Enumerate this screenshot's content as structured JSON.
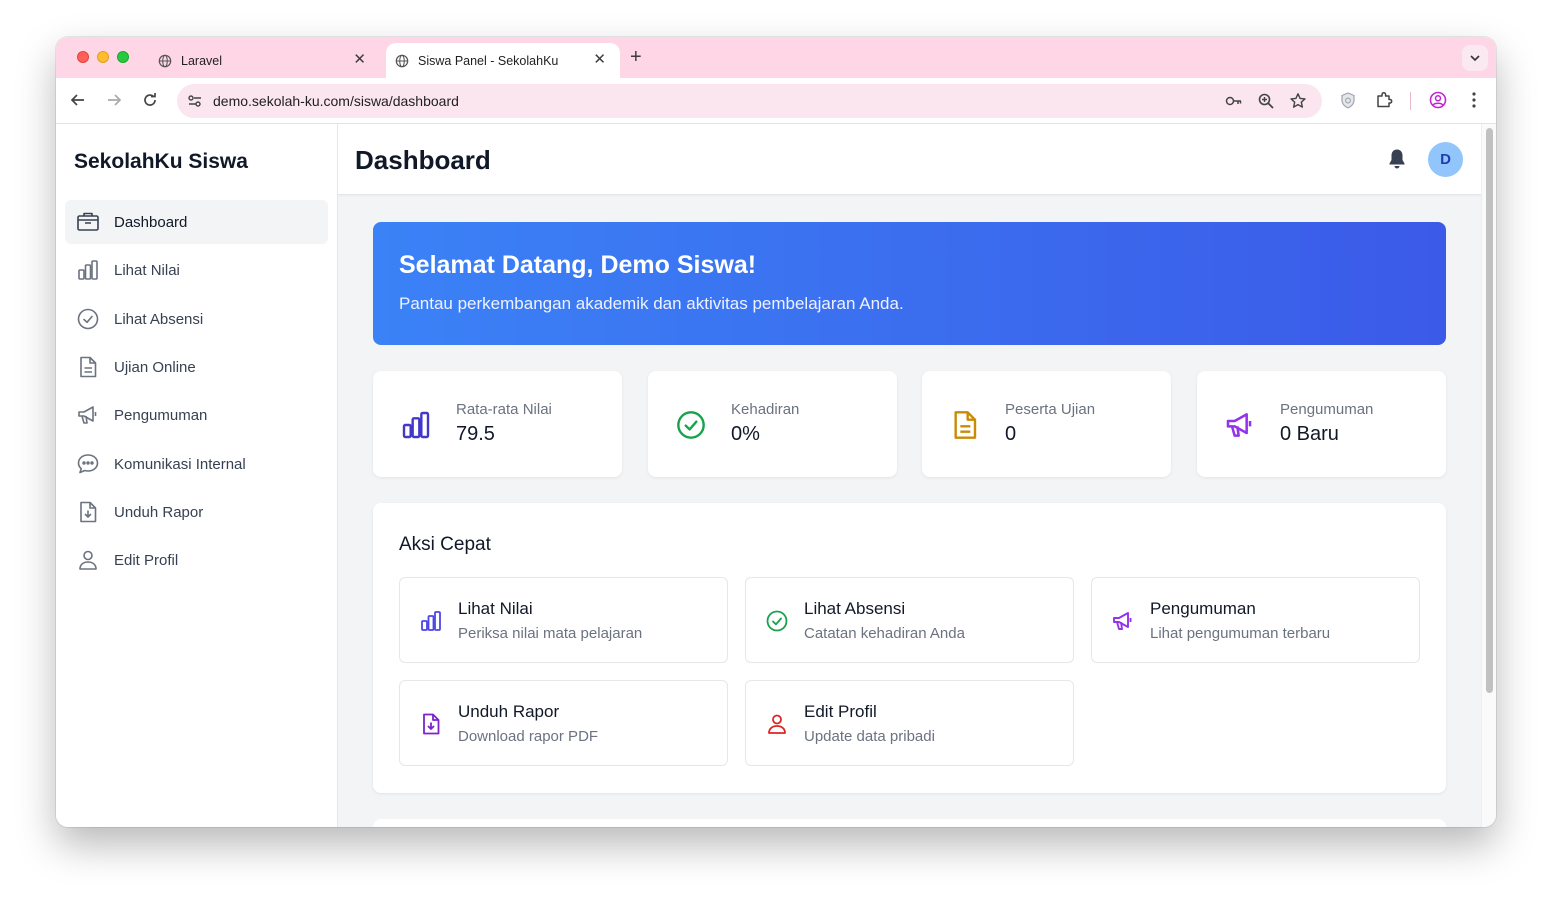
{
  "browser": {
    "tabs": [
      {
        "title": "Laravel",
        "active": false
      },
      {
        "title": "Siswa Panel - SekolahKu",
        "active": true
      }
    ],
    "url": "demo.sekolah-ku.com/siswa/dashboard"
  },
  "sidebar": {
    "brand": "SekolahKu Siswa",
    "items": [
      {
        "label": "Dashboard",
        "icon": "dashboard-icon",
        "active": true
      },
      {
        "label": "Lihat Nilai",
        "icon": "chart-bar-icon"
      },
      {
        "label": "Lihat Absensi",
        "icon": "check-circle-icon"
      },
      {
        "label": "Ujian Online",
        "icon": "document-icon"
      },
      {
        "label": "Pengumuman",
        "icon": "megaphone-icon"
      },
      {
        "label": "Komunikasi Internal",
        "icon": "chat-bubble-icon"
      },
      {
        "label": "Unduh Rapor",
        "icon": "document-download-icon"
      },
      {
        "label": "Edit Profil",
        "icon": "user-icon"
      }
    ]
  },
  "header": {
    "title": "Dashboard",
    "avatar_initial": "D"
  },
  "hero": {
    "title": "Selamat Datang, Demo Siswa!",
    "subtitle": "Pantau perkembangan akademik dan aktivitas pembelajaran Anda."
  },
  "stats": [
    {
      "label": "Rata-rata Nilai",
      "value": "79.5",
      "icon": "chart-bar-icon",
      "color": "#4338ca"
    },
    {
      "label": "Kehadiran",
      "value": "0%",
      "icon": "check-circle-icon",
      "color": "#16a34a"
    },
    {
      "label": "Peserta Ujian",
      "value": "0",
      "icon": "document-icon",
      "color": "#ca8a04"
    },
    {
      "label": "Pengumuman",
      "value": "0 Baru",
      "icon": "megaphone-icon",
      "color": "#9333ea"
    }
  ],
  "quick_actions": {
    "title": "Aksi Cepat",
    "items": [
      {
        "title": "Lihat Nilai",
        "subtitle": "Periksa nilai mata pelajaran",
        "icon": "chart-bar-icon",
        "color": "#4f46e5"
      },
      {
        "title": "Lihat Absensi",
        "subtitle": "Catatan kehadiran Anda",
        "icon": "check-circle-icon",
        "color": "#16a34a"
      },
      {
        "title": "Pengumuman",
        "subtitle": "Lihat pengumuman terbaru",
        "icon": "megaphone-icon",
        "color": "#9333ea"
      },
      {
        "title": "Unduh Rapor",
        "subtitle": "Download rapor PDF",
        "icon": "document-download-icon",
        "color": "#7e22ce"
      },
      {
        "title": "Edit Profil",
        "subtitle": "Update data pribadi",
        "icon": "user-icon",
        "color": "#dc2626"
      }
    ]
  }
}
